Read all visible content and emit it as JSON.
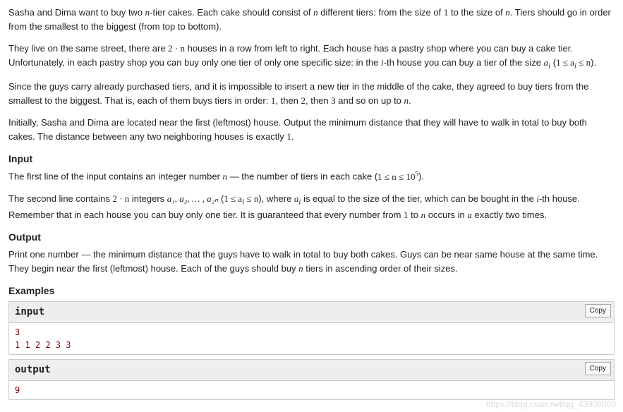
{
  "paragraphs": {
    "p1a": "Sasha and Dima want to buy two ",
    "p1b": "-tier cakes. Each cake should consist of ",
    "p1c": " different tiers: from the size of ",
    "p1d": " to the size of ",
    "p1e": ". Tiers should go in order from the smallest to the biggest (from top to bottom).",
    "p2a": "They live on the same street, there are ",
    "p2b": " houses in a row from left to right. Each house has a pastry shop where you can buy a cake tier. Unfortunately, in each pastry shop you can buy only one tier of only one specific size: in the ",
    "p2c": "-th house you can buy a tier of the size ",
    "p2d": ".",
    "p3a": "Since the guys carry already purchased tiers, and it is impossible to insert a new tier in the middle of the cake, they agreed to buy tiers from the smallest to the biggest. That is, each of them buys tiers in order: ",
    "p3b": ", then ",
    "p3c": ", then ",
    "p3d": " and so on up to ",
    "p3e": ".",
    "p4a": "Initially, Sasha and Dima are located near the first (leftmost) house. Output the minimum distance that they will have to walk in total to buy both cakes. The distance between any two neighboring houses is exactly ",
    "p4b": "."
  },
  "math": {
    "n": "n",
    "one": "1",
    "two": "2",
    "three": "3",
    "two_n": "2 · n",
    "i": "i",
    "a_i": "a",
    "a_i_sub": "i",
    "cond_a": "1 ≤ a",
    "cond_b": " ≤ n",
    "range_n_a": "1 ≤ n ≤ 10",
    "range_n_exp": "5",
    "seq": "a₁, a₂, … , a₂ₙ",
    "arr": "a"
  },
  "sections": {
    "input_title": "Input",
    "output_title": "Output",
    "examples_title": "Examples"
  },
  "input_desc": {
    "l1a": "The first line of the input contains an integer number ",
    "l1b": " — the number of tiers in each cake (",
    "l1c": ").",
    "l2a": "The second line contains ",
    "l2b": " integers ",
    "l2c": " (",
    "l2d": "), where ",
    "l2e": " is equal to the size of the tier, which can be bought in the ",
    "l2f": "-th house. Remember that in each house you can buy only one tier. It is guaranteed that every number from ",
    "l2g": " to ",
    "l2h": " occurs in ",
    "l2i": " exactly two times."
  },
  "output_desc": {
    "l1a": "Print one number  — the minimum distance that the guys have to walk in total to buy both cakes. Guys can be near same house at the same time. They begin near the first (leftmost) house. Each of the guys should buy ",
    "l1b": " tiers in ascending order of their sizes."
  },
  "examples": {
    "input_label": "input",
    "output_label": "output",
    "copy_label": "Copy",
    "input_data": "3\n1 1 2 2 3 3",
    "output_data": "9"
  },
  "watermark": "https://blog.csdn.net/qq_43906000"
}
